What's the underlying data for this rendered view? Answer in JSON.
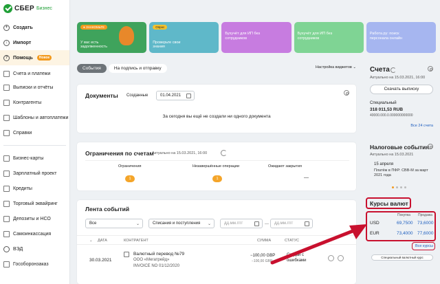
{
  "app": {
    "logo_text": "СБЕР",
    "logo_sub": "Бизнес"
  },
  "sidebar": {
    "top_items": [
      {
        "label": "Создать",
        "icon": "plus-icon"
      },
      {
        "label": "Импорт",
        "icon": "import-icon"
      },
      {
        "label": "Помощь",
        "icon": "help-icon",
        "badge": "Новое"
      }
    ],
    "items": [
      {
        "label": "Счета и платежи",
        "icon": "accounts-icon"
      },
      {
        "label": "Выписки и отчёты",
        "icon": "statements-icon"
      },
      {
        "label": "Контрагенты",
        "icon": "contractors-icon"
      },
      {
        "label": "Шаблоны и автоплатежи",
        "icon": "templates-icon"
      },
      {
        "label": "Справки",
        "icon": "certificates-icon"
      },
      {
        "label": "Бизнес-карты",
        "icon": "card-icon"
      },
      {
        "label": "Зарплатный проект",
        "icon": "salary-icon"
      },
      {
        "label": "Кредиты",
        "icon": "credit-icon"
      },
      {
        "label": "Торговый эквайринг",
        "icon": "acquiring-icon"
      },
      {
        "label": "Депозиты и НСО",
        "icon": "deposit-icon"
      },
      {
        "label": "Самоинкассация",
        "icon": "cash-icon"
      },
      {
        "label": "ВЭД",
        "icon": "globe-icon"
      },
      {
        "label": "Гособоронзаказ",
        "icon": "defense-icon"
      }
    ]
  },
  "banners": [
    {
      "tag": "● ЗНАКОМЬТЕ",
      "text": "У вас есть задолженность",
      "color": "#3fa35c"
    },
    {
      "tag": "Опрос",
      "text": "Проверьте свои знания",
      "color": "#5fb8c9"
    },
    {
      "tag": "",
      "text": "Бухучёт для ИП без сотрудников",
      "color": "#c77ce0"
    },
    {
      "tag": "",
      "text": "Бухучёт для ИП без сотрудников",
      "color": "#7fd494"
    },
    {
      "tag": "",
      "text": "Работа.ру: поиск персонала онлайн",
      "color": "#a6b6f0"
    }
  ],
  "tabs": {
    "events": "События",
    "sign": "На подпись и отправку",
    "widget_settings": "Настройка виджетов"
  },
  "documents": {
    "title": "Документы",
    "filter_label": "Созданные",
    "date": "01.04.2021",
    "empty_text": "За сегодня вы ещё не создали ни одного документа"
  },
  "restrictions": {
    "title": "Ограничения по счетам",
    "updated": "Актуально на 15.03.2021, 16:00",
    "cols": [
      {
        "label": "Ограничения",
        "count": "1"
      },
      {
        "label": "Незавершённые операции",
        "count": "1"
      },
      {
        "label": "Ожидают закрытия",
        "count": "—"
      }
    ]
  },
  "feed": {
    "title": "Лента событий",
    "filter_all": "Все",
    "filter_type": "Списания и поступления",
    "date_placeholder": "дд.мм.гггг",
    "headers": {
      "date": "ДАТА",
      "contractor": "КОНТРАГЕНТ",
      "sum": "СУММА",
      "status": "СТАТУС"
    },
    "rows": [
      {
        "date": "30.03.2021",
        "title": "Валютный перевод №79",
        "sub1": "ООО «Мегатрейд»",
        "sub2": "INVOICE NO 01/12/2020",
        "sum": "−100,00 GBP",
        "sum2": "−100,00 GBP",
        "status": "Создан с ошибками"
      }
    ]
  },
  "accounts": {
    "title": "Счета",
    "updated": "Актуально на 15.03.2021, 16:00",
    "button": "Скачать выписку",
    "acc_type": "Специальный",
    "amount": "318 011,53 RUB",
    "acc_number": "40000.000.0.000000000000",
    "all_link": "Все 24 счета"
  },
  "tax": {
    "title": "Налоговые события",
    "updated": "Актуально на 15.03.2021",
    "date": "15 апреля",
    "text": "Платёж в ПФР: СВВ-М за март 2021 года"
  },
  "rates": {
    "title": "Курсы валют",
    "col_buy": "Покупка",
    "col_sell": "Продажа",
    "rows": [
      {
        "cur": "USD",
        "buy": "69,7500",
        "sell": "73,6000"
      },
      {
        "cur": "EUR",
        "buy": "73,4000",
        "sell": "77,6000"
      }
    ],
    "all_link": "Все курсы",
    "special_button": "Специальный валютный курс"
  },
  "colors": {
    "accent": "#21a038",
    "highlight": "#c8102e",
    "link": "#1f5fbf",
    "orange": "#f4a52a"
  }
}
